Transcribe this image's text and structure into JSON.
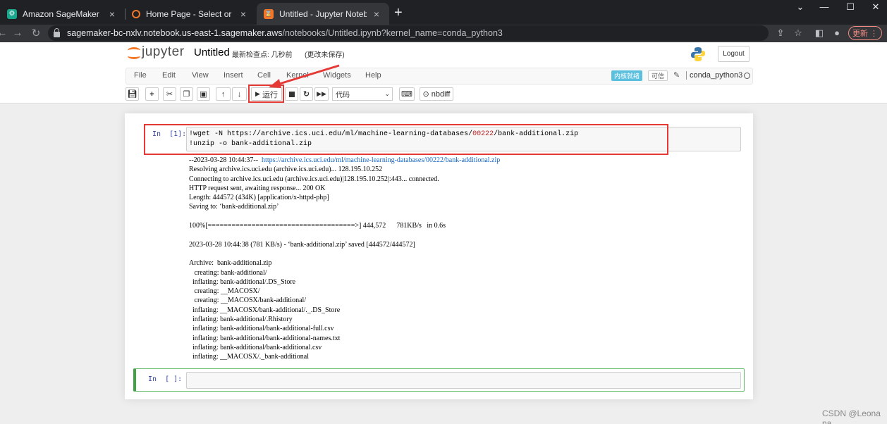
{
  "browser": {
    "tabs": [
      {
        "title": "Amazon SageMaker",
        "active": false
      },
      {
        "title": "Home Page - Select or create a",
        "active": false
      },
      {
        "title": "Untitled - Jupyter Notebook",
        "active": true
      }
    ],
    "new_tab": "+",
    "url_host": "sagemaker-bc-nxlv.notebook.us-east-1.sagemaker.aws",
    "url_path": "/notebooks/Untitled.ipynb?kernel_name=conda_python3",
    "update_label": "更新"
  },
  "jupyter": {
    "logo_text": "jupyter",
    "notebook_title": "Untitled",
    "checkpoint": "最新检查点: 几秒前",
    "unsaved": "(更改未保存)",
    "logout_label": "Logout",
    "menu": [
      "File",
      "Edit",
      "View",
      "Insert",
      "Cell",
      "Kernel",
      "Widgets",
      "Help"
    ],
    "kernel_status": "内核就绪",
    "trusted_label": "可信",
    "kernel_name": "conda_python3",
    "toolbar": {
      "run_label": "运行",
      "cell_type": "代码",
      "nbdiff_label": "nbdiff"
    },
    "accent_color": "#f37726"
  },
  "cells": {
    "cell1": {
      "prompt": "In  [1]:",
      "code_line1_cmd": "!wget -N ",
      "code_line1_url_a": "https://archive.ics.uci.edu/ml/machine-learning-databases/",
      "code_line1_num": "00222",
      "code_line1_url_b": "/bank-additional.zip",
      "code_line2": "!unzip -o bank-additional.zip",
      "output": [
        {
          "text": "--2023-03-28 10:44:37--  ",
          "link": "https://archive.ics.uci.edu/ml/machine-learning-databases/00222/bank-additional.zip"
        },
        {
          "text": "Resolving archive.ics.uci.edu (archive.ics.uci.edu)... 128.195.10.252"
        },
        {
          "text": "Connecting to archive.ics.uci.edu (archive.ics.uci.edu)|128.195.10.252|:443... connected."
        },
        {
          "text": "HTTP request sent, awaiting response... 200 OK"
        },
        {
          "text": "Length: 444572 (434K) [application/x-httpd-php]"
        },
        {
          "text": "Saving to: ‘bank-additional.zip’"
        },
        {
          "text": ""
        },
        {
          "text": "100%[=====================================>] 444,572      781KB/s   in 0.6s"
        },
        {
          "text": ""
        },
        {
          "text": "2023-03-28 10:44:38 (781 KB/s) - ‘bank-additional.zip’ saved [444572/444572]"
        },
        {
          "text": ""
        },
        {
          "text": "Archive:  bank-additional.zip"
        },
        {
          "text": "   creating: bank-additional/"
        },
        {
          "text": "  inflating: bank-additional/.DS_Store"
        },
        {
          "text": "   creating: __MACOSX/"
        },
        {
          "text": "   creating: __MACOSX/bank-additional/"
        },
        {
          "text": "  inflating: __MACOSX/bank-additional/._.DS_Store"
        },
        {
          "text": "  inflating: bank-additional/.Rhistory"
        },
        {
          "text": "  inflating: bank-additional/bank-additional-full.csv"
        },
        {
          "text": "  inflating: bank-additional/bank-additional-names.txt"
        },
        {
          "text": "  inflating: bank-additional/bank-additional.csv"
        },
        {
          "text": "  inflating: __MACOSX/._bank-additional"
        }
      ]
    },
    "cell2": {
      "prompt": "In  [ ]:"
    }
  },
  "watermark": "CSDN @Leona na"
}
